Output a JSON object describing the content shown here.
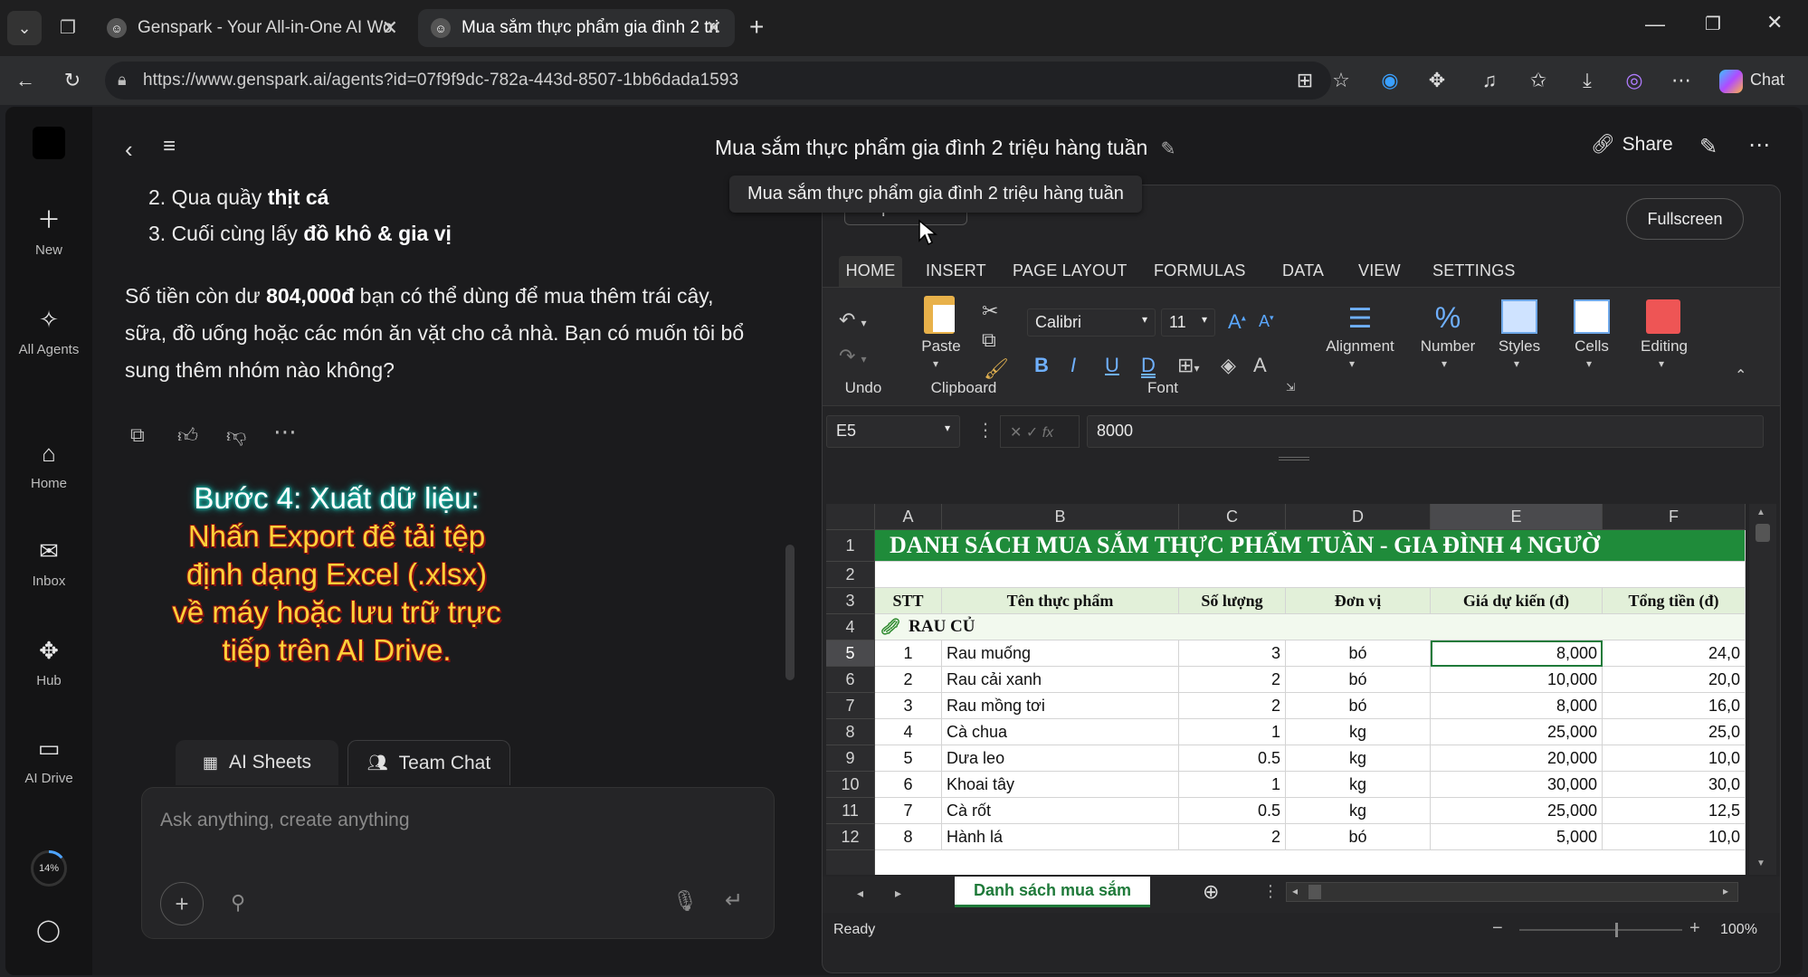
{
  "browser": {
    "tabs": [
      {
        "label": "Genspark - Your All-in-One AI Wo",
        "active": false
      },
      {
        "label": "Mua sắm thực phẩm gia đình 2 tri",
        "active": true
      }
    ],
    "url": "https://www.genspark.ai/agents?id=07f9f9dc-782a-443d-8507-1bb6dada1593",
    "chat_label": "Chat"
  },
  "rail": {
    "items": [
      {
        "label": "New",
        "icon": "plus-icon"
      },
      {
        "label": "All Agents",
        "icon": "sparkle-icon"
      },
      {
        "label": "Home",
        "icon": "home-icon"
      },
      {
        "label": "Inbox",
        "icon": "inbox-icon"
      },
      {
        "label": "Hub",
        "icon": "hub-icon"
      },
      {
        "label": "AI Drive",
        "icon": "folder-icon"
      }
    ],
    "progress": "14%",
    "progress_value": 0.14
  },
  "chat": {
    "steps": [
      {
        "num": "2. Qua quầy ",
        "bold": "thịt cá"
      },
      {
        "num": "3. Cuối cùng lấy ",
        "bold": "đồ khô & gia vị"
      }
    ],
    "para_lines": [
      {
        "pre": "Số tiền còn dư ",
        "bold": "804,000đ",
        "post": " bạn có thể dùng để mua thêm trái cây,"
      },
      {
        "pre": "sữa, đồ uống hoặc các món ăn vặt cho cả nhà. Bạn có muốn tôi bổ",
        "bold": "",
        "post": ""
      },
      {
        "pre": "sung thêm nhóm nào không?",
        "bold": "",
        "post": ""
      }
    ],
    "overlay": {
      "line1": "Bước 4: Xuất dữ liệu:",
      "lines": [
        "Nhấn Export để tải tệp",
        "định dạng Excel (.xlsx)",
        "về máy hoặc lưu trữ trực",
        "tiếp trên AI Drive."
      ]
    },
    "tabs": {
      "sheets": "AI Sheets",
      "team": "Team Chat"
    },
    "input_placeholder": "Ask anything, create anything"
  },
  "header": {
    "title": "Mua sắm thực phẩm gia đình 2 triệu hàng tuần",
    "tooltip": "Mua sắm thực phẩm gia đình 2 triệu hàng tuần",
    "share": "Share"
  },
  "sheet": {
    "export_label": "Export",
    "fullscreen": "Fullscreen",
    "ribbon_tabs": [
      "HOME",
      "INSERT",
      "PAGE LAYOUT",
      "FORMULAS",
      "DATA",
      "VIEW",
      "SETTINGS"
    ],
    "groups": {
      "undo": "Undo",
      "paste": "Paste",
      "clipboard": "Clipboard",
      "font": "Font",
      "alignment": "Alignment",
      "number": "Number",
      "styles": "Styles",
      "cells": "Cells",
      "editing": "Editing"
    },
    "font_name": "Calibri",
    "font_size": "11",
    "cell_ref": "E5",
    "formula_value": "8000",
    "col_headers": [
      "A",
      "B",
      "C",
      "D",
      "E",
      "F"
    ],
    "title_row": "DANH SÁCH MUA SẮM THỰC PHẨM TUẦN - GIA ĐÌNH 4 NGƯỜ",
    "table_headers": [
      "STT",
      "Tên thực phẩm",
      "Số lượng",
      "Đơn vị",
      "Giá dự kiến (đ)",
      "Tổng tiền (đ)"
    ],
    "section": "RAU CỦ",
    "rows": [
      {
        "r": "5",
        "stt": "1",
        "name": "Rau muống",
        "qty": "3",
        "unit": "bó",
        "price": "8,000",
        "total": "24,0"
      },
      {
        "r": "6",
        "stt": "2",
        "name": "Rau cải xanh",
        "qty": "2",
        "unit": "bó",
        "price": "10,000",
        "total": "20,0"
      },
      {
        "r": "7",
        "stt": "3",
        "name": "Rau mồng tơi",
        "qty": "2",
        "unit": "bó",
        "price": "8,000",
        "total": "16,0"
      },
      {
        "r": "8",
        "stt": "4",
        "name": "Cà chua",
        "qty": "1",
        "unit": "kg",
        "price": "25,000",
        "total": "25,0"
      },
      {
        "r": "9",
        "stt": "5",
        "name": "Dưa leo",
        "qty": "0.5",
        "unit": "kg",
        "price": "20,000",
        "total": "10,0"
      },
      {
        "r": "10",
        "stt": "6",
        "name": "Khoai tây",
        "qty": "1",
        "unit": "kg",
        "price": "30,000",
        "total": "30,0"
      },
      {
        "r": "11",
        "stt": "7",
        "name": "Cà rốt",
        "qty": "0.5",
        "unit": "kg",
        "price": "25,000",
        "total": "12,5"
      },
      {
        "r": "12",
        "stt": "8",
        "name": "Hành lá",
        "qty": "2",
        "unit": "bó",
        "price": "5,000",
        "total": "10,0"
      }
    ],
    "row_nums": [
      "1",
      "2",
      "3",
      "4"
    ],
    "sheet_tab": "Danh sách mua sắm",
    "status": "Ready",
    "zoom": "100%",
    "colors": {
      "title_green": "#1f8b3a",
      "header_bg": "#e2f0d9",
      "accent": "#1f7a3a"
    }
  }
}
